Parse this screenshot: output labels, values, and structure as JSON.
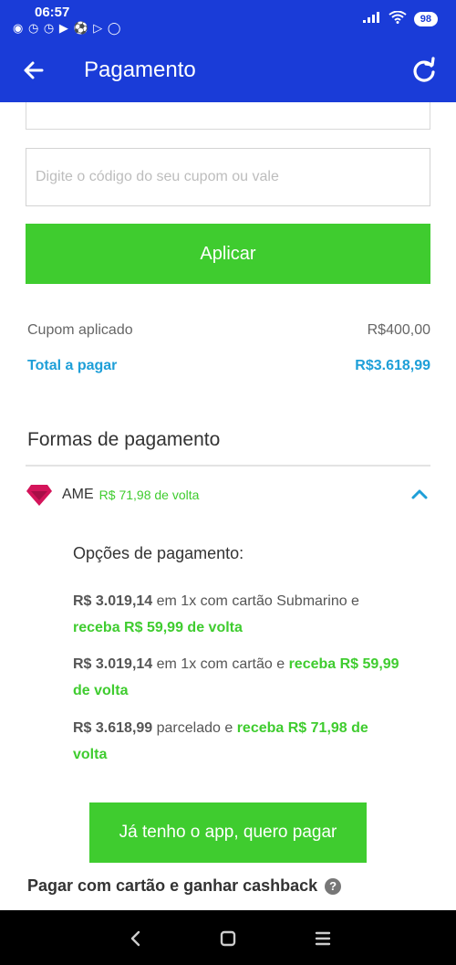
{
  "status_bar": {
    "time": "06:57",
    "battery": "98"
  },
  "app_bar": {
    "title": "Pagamento"
  },
  "coupon": {
    "placeholder": "Digite o código do seu cupom ou vale",
    "value": "",
    "apply_label": "Aplicar"
  },
  "summary": {
    "coupon_label": "Cupom aplicado",
    "coupon_value": "R$400,00",
    "total_label": "Total a pagar",
    "total_value": "R$3.618,99"
  },
  "payment": {
    "section_title": "Formas de pagamento",
    "ame": {
      "name": "AME",
      "cashback": "R$ 71,98 de volta",
      "expanded": true
    },
    "options_title": "Opções de pagamento:",
    "options": [
      {
        "amount": "R$ 3.019,14",
        "text": " em 1x com cartão Submarino e ",
        "cashback": "receba R$ 59,99 de volta"
      },
      {
        "amount": "R$ 3.019,14",
        "text": " em 1x com cartão e ",
        "cashback": "receba R$ 59,99 de volta"
      },
      {
        "amount": "R$ 3.618,99",
        "text": " parcelado e ",
        "cashback": "receba R$ 71,98 de volta"
      }
    ],
    "app_pay_label": "Já tenho o app, quero pagar",
    "card_cashback_label": "Pagar com cartão e ganhar cashback"
  },
  "colors": {
    "primary": "#1a3cd8",
    "accent_green": "#3fcc2f",
    "total_blue": "#1e9fd8",
    "ame_pink": "#d4145a"
  }
}
